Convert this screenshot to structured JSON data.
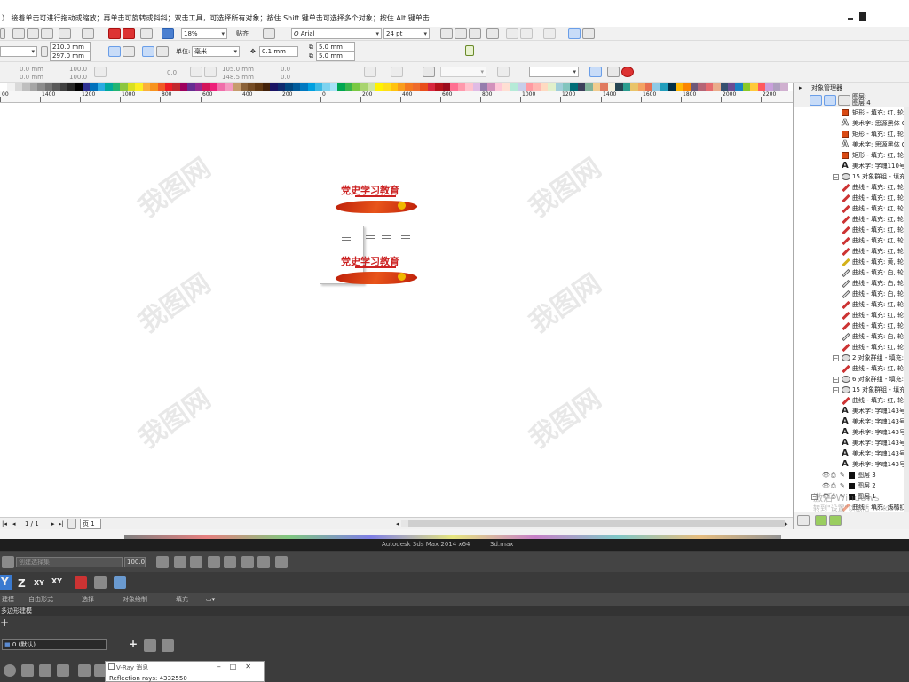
{
  "hint_bar": {
    "text": "）  接着单击可进行拖动或缩放；再单击可旋转或斜斜；双击工具，可选择所有对象；按住 Shift 键单击可选择多个对象；按住 Alt 键单击..."
  },
  "toolbar1": {
    "zoom": "18%",
    "snap_label": "贴齐",
    "font_name": "Arial",
    "font_size": "24 pt"
  },
  "toolbar2": {
    "width": "210.0 mm",
    "height": "297.0 mm",
    "unit_label": "单位:",
    "unit_value": "毫米",
    "nudge": "0.1 mm",
    "dup_x": "5.0 mm",
    "dup_y": "5.0 mm"
  },
  "toolbar3": {
    "x1": "0.0 mm",
    "y1": "0.0 mm",
    "sx": "100.0",
    "sy": "100.0",
    "angle": "0.0",
    "w2": "105.0 mm",
    "h2": "148.5 mm",
    "s3": "0.0",
    "s4": "0.0"
  },
  "palette": {
    "colors": [
      "#ffffff",
      "#f2f2f2",
      "#d9d9d9",
      "#bfbfbf",
      "#a6a6a6",
      "#8c8c8c",
      "#737373",
      "#595959",
      "#404040",
      "#262626",
      "#000000",
      "#2e3192",
      "#0071bc",
      "#29abe2",
      "#00a99d",
      "#22b573",
      "#8cc63f",
      "#d9e021",
      "#fcee21",
      "#fbb03b",
      "#f7931e",
      "#f15a24",
      "#ed1c24",
      "#c1272d",
      "#9e005d",
      "#662d91",
      "#93278f",
      "#d4145a",
      "#ed1e79",
      "#f06eaa",
      "#f49ac1",
      "#c69c6d",
      "#8b6239",
      "#754c24",
      "#603813",
      "#42210b",
      "#1b1464",
      "#0e2a6e",
      "#00467f",
      "#005b9a",
      "#0079c1",
      "#00a0e0",
      "#3cb9e4",
      "#7dd3f0",
      "#a7e2f6",
      "#00a651",
      "#39b54a",
      "#7ac943",
      "#a8d46f",
      "#cbe3a2",
      "#fff200",
      "#ffde17",
      "#ffc20e",
      "#f99d1c",
      "#f47920",
      "#ee6b2b",
      "#e94e1b",
      "#d7263d",
      "#b5121b",
      "#9b0c1d",
      "#ff6f91",
      "#ff99ac",
      "#ffc2cd",
      "#e0bbe4",
      "#957dad",
      "#d291bc",
      "#fec8d8",
      "#ffdfd3",
      "#b5ead7",
      "#c7ceea",
      "#ff9aa2",
      "#ffb7b2",
      "#ffdac1",
      "#e2f0cb",
      "#a0ced9",
      "#83c5be",
      "#006d77",
      "#3d405b",
      "#81b29a",
      "#f2cc8f",
      "#e07a5f",
      "#f4f1de",
      "#264653",
      "#2a9d8f",
      "#e9c46a",
      "#f4a261",
      "#e76f51",
      "#8ecae6",
      "#219ebc",
      "#023047",
      "#ffb703",
      "#fb8500",
      "#6d597a",
      "#b56576",
      "#e56b6f",
      "#eaac8b",
      "#355070",
      "#6a4c93",
      "#1982c4",
      "#8ac926",
      "#ffca3a",
      "#ff595e",
      "#c9a0dc",
      "#b0a0c0",
      "#d0b0d0"
    ]
  },
  "ruler": {
    "ticks": [
      "00",
      "1400",
      "1200",
      "1000",
      "800",
      "600",
      "400",
      "200",
      "0",
      "200",
      "400",
      "600",
      "800",
      "1000",
      "1200",
      "1400",
      "1600",
      "1800",
      "2000",
      "2200"
    ]
  },
  "canvas": {
    "watermark": "我图网",
    "artwork_title": "党史学习教育"
  },
  "nav": {
    "page_count": "1 / 1",
    "page_tab": "页 1"
  },
  "docker": {
    "title": "对象管理器",
    "root_a": "图层:",
    "root_b": "图层 4",
    "rows": [
      {
        "icon": "rect",
        "label": "矩形 - 填充: 红, 轮廓"
      },
      {
        "icon": "A-out",
        "label": "美术字: 思源黑体 C"
      },
      {
        "icon": "rect",
        "label": "矩形 - 填充: 红, 轮廓"
      },
      {
        "icon": "A-out",
        "label": "美术字: 思源黑体 C"
      },
      {
        "icon": "rect",
        "label": "矩形 - 填充: 红, 轮廓"
      },
      {
        "icon": "A",
        "label": "美术字: 字魂110号"
      },
      {
        "icon": "grp",
        "label": "15 对象群组 - 填充:"
      },
      {
        "icon": "pen",
        "label": "曲线 - 填充: 红, 轮廓"
      },
      {
        "icon": "pen",
        "label": "曲线 - 填充: 红, 轮廓"
      },
      {
        "icon": "pen",
        "label": "曲线 - 填充: 红, 轮廓"
      },
      {
        "icon": "pen",
        "label": "曲线 - 填充: 红, 轮廓"
      },
      {
        "icon": "pen",
        "label": "曲线 - 填充: 红, 轮廓"
      },
      {
        "icon": "pen",
        "label": "曲线 - 填充: 红, 轮廓"
      },
      {
        "icon": "pen",
        "label": "曲线 - 填充: 红, 轮廓"
      },
      {
        "icon": "pen-y",
        "label": "曲线 - 填充: 黄, 轮廓"
      },
      {
        "icon": "pen-w",
        "label": "曲线 - 填充: 白, 轮廓"
      },
      {
        "icon": "pen-w",
        "label": "曲线 - 填充: 白, 轮廓"
      },
      {
        "icon": "pen-w",
        "label": "曲线 - 填充: 白, 轮廓"
      },
      {
        "icon": "pen",
        "label": "曲线 - 填充: 红, 轮廓"
      },
      {
        "icon": "pen",
        "label": "曲线 - 填充: 红, 轮廓"
      },
      {
        "icon": "pen",
        "label": "曲线 - 填充: 红, 轮廓"
      },
      {
        "icon": "pen-w",
        "label": "曲线 - 填充: 白, 轮廓"
      },
      {
        "icon": "pen",
        "label": "曲线 - 填充: 红, 轮廓"
      },
      {
        "icon": "grp",
        "label": "2 对象群组 - 填充: 白"
      },
      {
        "icon": "pen",
        "label": "曲线 - 填充: 红, 轮廓"
      },
      {
        "icon": "grp",
        "label": "6 对象群组 - 填充: 红"
      },
      {
        "icon": "grp",
        "label": "15 对象群组 - 填充:"
      },
      {
        "icon": "pen",
        "label": "曲线 - 填充: 红, 轮廓"
      },
      {
        "icon": "A",
        "label": "美术字: 字魂143号"
      },
      {
        "icon": "A",
        "label": "美术字: 字魂143号"
      },
      {
        "icon": "A",
        "label": "美术字: 字魂143号"
      },
      {
        "icon": "A",
        "label": "美术字: 字魂143号"
      },
      {
        "icon": "A",
        "label": "美术字: 字魂143号"
      },
      {
        "icon": "A",
        "label": "美术字: 字魂143号"
      }
    ],
    "layers": [
      {
        "label": "图层 3"
      },
      {
        "label": "图层 2"
      },
      {
        "label": "图层 1"
      }
    ],
    "layer1_children": [
      {
        "label": "曲线 - 填充: 浅橘红, 轮"
      },
      {
        "label": "曲线 - 填充: 浅橘红, 轮"
      }
    ],
    "activate_text": "激活 Windows",
    "activate_sub": "转到\"设置\"以激活 Windows"
  },
  "max": {
    "window_title": "Autodesk 3ds Max  2014 x64",
    "file_name": "3d.max",
    "axes": [
      "Y",
      "Z",
      "XY",
      "XY"
    ],
    "field_placeholder": "创建选择集",
    "field_value": "100.0",
    "tabs": [
      "建模",
      "自由形式",
      "选择",
      "对象绘制",
      "填充"
    ],
    "sub_title": "多边形建模",
    "layer_default": "0 (默认)",
    "vray_title": "V-Ray 消息",
    "vray_text": "Reflection rays: 4332550"
  }
}
